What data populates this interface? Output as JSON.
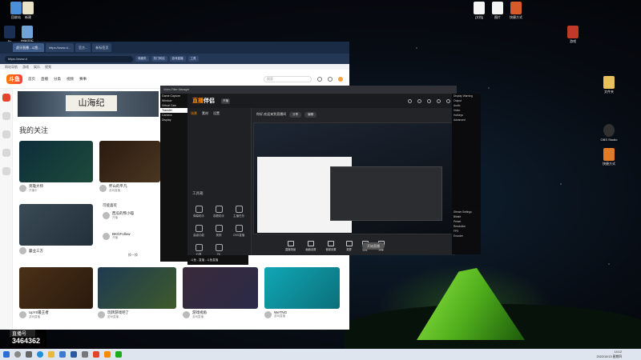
{
  "colors": {
    "accent": "#ff8a00",
    "tent": "#7ad62a",
    "brand_red": "#e2452b"
  },
  "desktop_icons": [
    {
      "label": "回收站",
      "icon": "recycle-bin-icon",
      "color": "#4a8fd8"
    },
    {
      "label": "新建",
      "icon": "file-icon",
      "color": "#e9e3c8"
    },
    {
      "label": "Ps",
      "icon": "photoshop-icon",
      "color": "#1b2f55"
    },
    {
      "label": "控制面板",
      "icon": "control-panel-icon",
      "color": "#6fa3d9"
    },
    {
      "label": "[文档]",
      "icon": "document-icon",
      "color": "#f4f4f4"
    },
    {
      "label": "图片",
      "icon": "image-icon",
      "color": "#f4f4f4"
    },
    {
      "label": "快捷方式",
      "icon": "shortcut-icon",
      "color": "#d75a2a"
    },
    {
      "label": "游戏",
      "icon": "game-icon",
      "color": "#c03a2a"
    },
    {
      "label": "OBS Studio",
      "icon": "obs-icon",
      "color": "#303030"
    },
    {
      "label": "文件夹",
      "icon": "folder-icon",
      "color": "#e8c15a"
    },
    {
      "label": "快捷方式",
      "icon": "app-icon",
      "color": "#e07b28"
    }
  ],
  "browser": {
    "tabs": [
      {
        "label": "虎牙直播 - 斗鱼...",
        "active": true
      },
      {
        "label": "https://www.d...",
        "active": false
      },
      {
        "label": "官方...",
        "active": false
      },
      {
        "label": "新标签页",
        "active": false
      }
    ],
    "url": "https://www.d",
    "favorites": [
      "收藏夹",
      "热门网站",
      "游戏直播",
      "工具"
    ],
    "bookmarks": [
      "网站导航",
      "游戏",
      "娱乐",
      "视频"
    ],
    "site": {
      "logo": "斗鱼",
      "nav": [
        "首页",
        "直播",
        "分类",
        "视频",
        "赛事"
      ],
      "search_placeholder": "搜索",
      "banner_title": "山海纪",
      "section_title": "我的关注",
      "cards": [
        {
          "name": "英雄大师",
          "sub": "开播中"
        },
        {
          "name": "怀山的平凡",
          "sub": "游戏直播"
        },
        {
          "name": "霸业三方",
          "sub": "开播中"
        },
        {
          "name": "UpYrl最王者",
          "sub": "游戏直播"
        },
        {
          "name": "玩转游戏吧了",
          "sub": "游戏直播"
        },
        {
          "name": "游戏视角",
          "sub": "游戏直播"
        },
        {
          "name": "WeTNG",
          "sub": "游戏直播"
        }
      ],
      "recommend_title": "可能喜欢",
      "recommend": [
        {
          "name": "西瓜的熊小喵",
          "sub": "开播"
        },
        {
          "name": "BKGFollow",
          "sub": "开播"
        }
      ],
      "more_label": "换一换"
    }
  },
  "stream_app": {
    "logo_main": "直播",
    "logo_sub": "伴侣",
    "tag": "开播",
    "left_tabs": [
      "场景",
      "素材",
      "设置"
    ],
    "tools_title": "工具箱",
    "tools": [
      "弹幕助手",
      "观看助手",
      "主播任务",
      "高级功能",
      "美颜",
      "OBS直播",
      "分享",
      "PK"
    ],
    "room_title": "你好,欢迎来到直播间",
    "room_buttons": [
      "分享",
      "编辑"
    ],
    "bottom": [
      "直播场景",
      "画面设置",
      "音频设置",
      "录屏",
      "连麦",
      "弹幕"
    ],
    "live_button": "开始直播"
  },
  "filter_window": {
    "title": "Video Filter Manager",
    "rows": [
      "Game Capture",
      "Window",
      "Virtual Cam",
      "Transfer",
      "Camera",
      "Display"
    ]
  },
  "settings_window": {
    "title": "Display Warning",
    "rows": [
      "Output",
      "Audio",
      "Video",
      "Hotkeys",
      "Advanced"
    ]
  },
  "stream_settings": {
    "title": "Stream Settings",
    "rows": [
      "Bitrate",
      "Preset",
      "Resolution",
      "FPS",
      "Encoder"
    ]
  },
  "popup": {
    "label": "斗鱼 - 直播 - 斗鱼直播"
  },
  "live_overlay": {
    "label": "直播号",
    "number": "3464362"
  },
  "taskbar": {
    "icons": [
      "start-icon",
      "search-icon",
      "taskview-icon",
      "browser-icon",
      "folder-icon",
      "store-icon",
      "mail-icon",
      "settings-icon",
      "app-icon",
      "video-icon",
      "chat-icon"
    ],
    "time": "14:12",
    "date": "2022/10/13 星期四"
  }
}
